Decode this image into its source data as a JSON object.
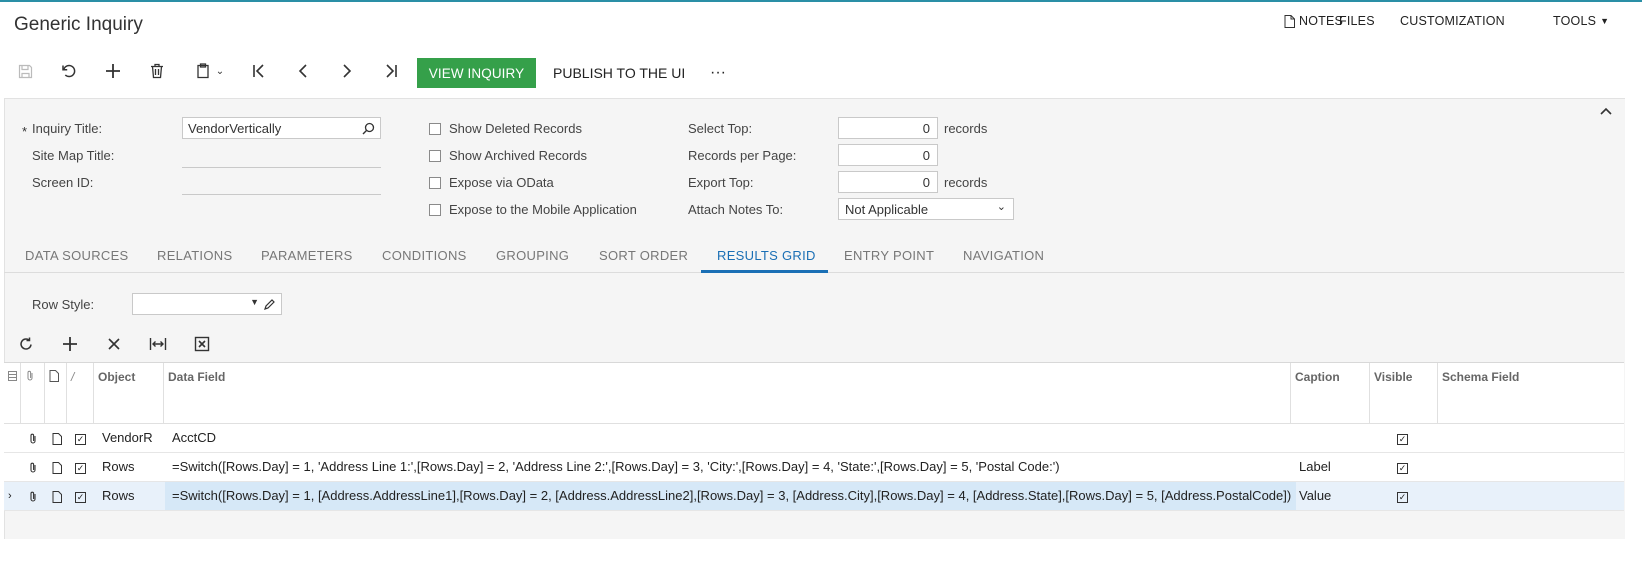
{
  "header": {
    "title": "Generic Inquiry",
    "nav": [
      "NOTES",
      "FILES",
      "CUSTOMIZATION",
      "TOOLS"
    ]
  },
  "toolbar": {
    "view_inquiry": "VIEW INQUIRY",
    "publish": "PUBLISH TO THE UI",
    "more": "···"
  },
  "form": {
    "inquiry_title_label": "Inquiry Title:",
    "inquiry_title_value": "VendorVertically",
    "site_map_title_label": "Site Map Title:",
    "screen_id_label": "Screen ID:",
    "show_deleted": "Show Deleted Records",
    "show_archived": "Show Archived Records",
    "expose_odata": "Expose via OData",
    "expose_mobile": "Expose to the Mobile Application",
    "select_top_label": "Select Top:",
    "select_top_value": "0",
    "records_per_page_label": "Records per Page:",
    "records_per_page_value": "0",
    "export_top_label": "Export Top:",
    "export_top_value": "0",
    "records_unit": "records",
    "attach_notes_label": "Attach Notes To:",
    "attach_notes_value": "Not Applicable"
  },
  "tabs": [
    "DATA SOURCES",
    "RELATIONS",
    "PARAMETERS",
    "CONDITIONS",
    "GROUPING",
    "SORT ORDER",
    "RESULTS GRID",
    "ENTRY POINT",
    "NAVIGATION"
  ],
  "active_tab": "RESULTS GRID",
  "results": {
    "row_style_label": "Row Style:",
    "columns": [
      "Object",
      "Data Field",
      "Caption",
      "Visible",
      "Schema Field"
    ],
    "rows": [
      {
        "object": "VendorR",
        "data_field": "AcctCD",
        "caption": "",
        "visible": true
      },
      {
        "object": "Rows",
        "data_field": "=Switch([Rows.Day] = 1, 'Address Line 1:',[Rows.Day] = 2, 'Address Line 2:',[Rows.Day] = 3, 'City:',[Rows.Day] = 4, 'State:',[Rows.Day] = 5, 'Postal Code:')",
        "caption": "Label",
        "visible": true
      },
      {
        "object": "Rows",
        "data_field": "=Switch([Rows.Day] = 1, [Address.AddressLine1],[Rows.Day] = 2, [Address.AddressLine2],[Rows.Day] = 3, [Address.City],[Rows.Day] = 4, [Address.State],[Rows.Day] = 5, [Address.PostalCode])",
        "caption": "Value",
        "visible": true
      }
    ]
  }
}
